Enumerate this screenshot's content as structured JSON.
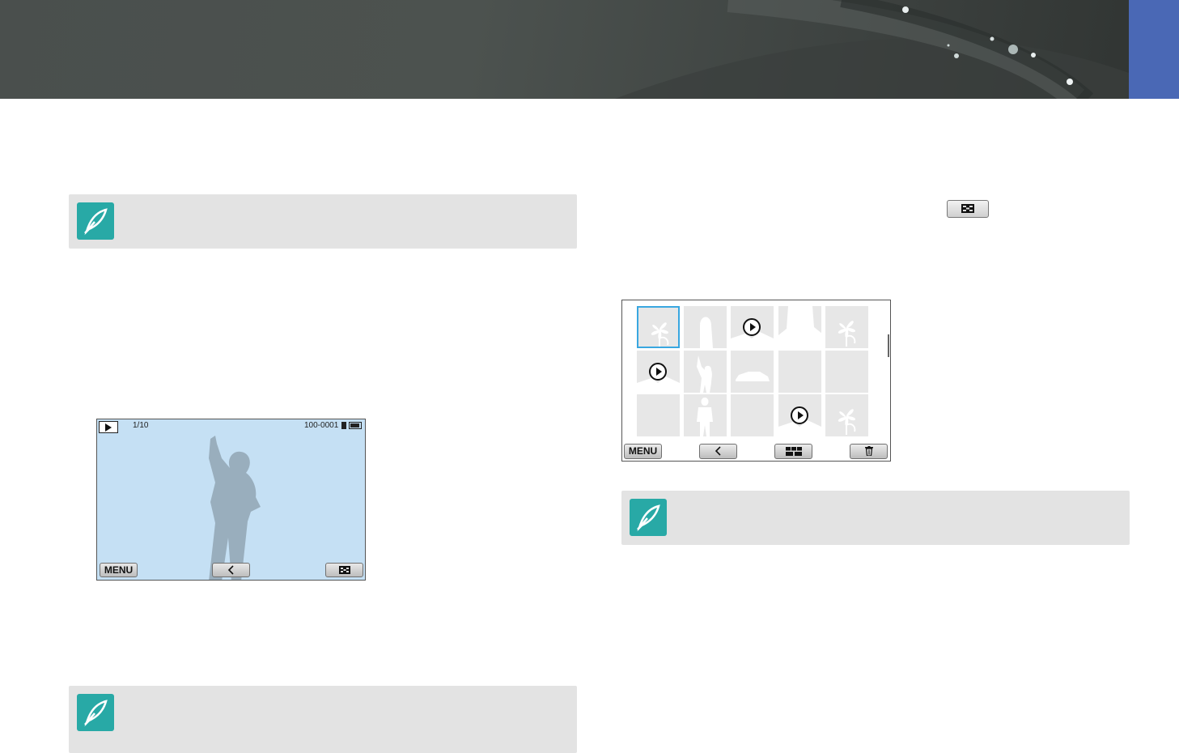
{
  "colors": {
    "banner": "#4a4f4d",
    "chapter_tab": "#4a68b5",
    "note_bg": "#e3e3e3",
    "note_icon": "#28a9a6",
    "lcd_bg": "#c5e0f4",
    "selection": "#39a7e0"
  },
  "icons": {
    "note": "note-pen-icon",
    "thumbnail": "thumbnail-view-icon",
    "play": "play-mode-icon",
    "back": "back-arrow-icon",
    "delete": "trash-icon",
    "calendar": "calendar-view-icon"
  },
  "single_view": {
    "counter": "1/10",
    "file_number": "100-0001",
    "menu_label": "MENU"
  },
  "thumbnail_view": {
    "menu_label": "MENU",
    "cells": [
      {
        "content": "flower",
        "video": false,
        "selected": true
      },
      {
        "content": "person",
        "video": false,
        "selected": false
      },
      {
        "content": "scene",
        "video": true,
        "selected": false
      },
      {
        "content": "portrait",
        "video": false,
        "selected": false
      },
      {
        "content": "flower",
        "video": false,
        "selected": false
      },
      {
        "content": "scene",
        "video": true,
        "selected": false
      },
      {
        "content": "child",
        "video": false,
        "selected": false
      },
      {
        "content": "car",
        "video": false,
        "selected": false
      },
      {
        "content": "blank",
        "video": false,
        "selected": false
      },
      {
        "content": "blank",
        "video": false,
        "selected": false
      },
      {
        "content": "blank",
        "video": false,
        "selected": false
      },
      {
        "content": "man",
        "video": false,
        "selected": false
      },
      {
        "content": "blank",
        "video": false,
        "selected": false
      },
      {
        "content": "scene",
        "video": true,
        "selected": false
      },
      {
        "content": "flower",
        "video": false,
        "selected": false
      }
    ]
  }
}
